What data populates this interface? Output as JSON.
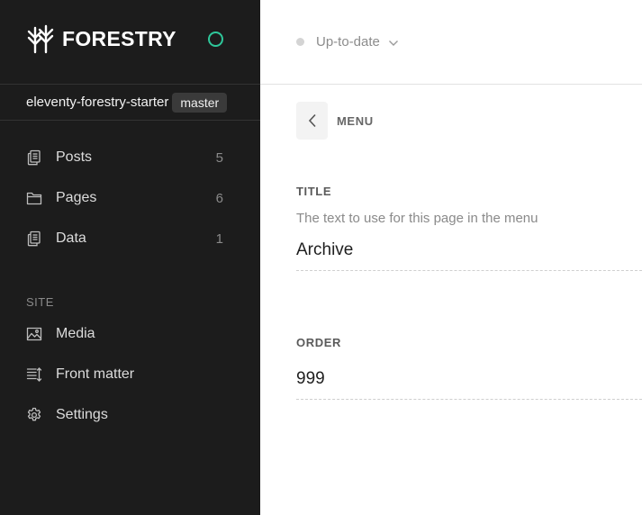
{
  "brand": {
    "name": "FORESTRY",
    "status_color": "#2ec79a"
  },
  "repo": {
    "name": "eleventy-forestry-starter",
    "branch": "master"
  },
  "nav": {
    "content": [
      {
        "label": "Posts",
        "count": "5",
        "icon": "document-stack-icon"
      },
      {
        "label": "Pages",
        "count": "6",
        "icon": "folder-icon"
      },
      {
        "label": "Data",
        "count": "1",
        "icon": "document-stack-icon"
      }
    ],
    "site_label": "SITE",
    "site": [
      {
        "label": "Media",
        "icon": "image-icon"
      },
      {
        "label": "Front matter",
        "icon": "front-matter-icon"
      },
      {
        "label": "Settings",
        "icon": "gear-icon"
      }
    ]
  },
  "topbar": {
    "sync_status": "Up-to-date"
  },
  "editor": {
    "breadcrumb": "MENU",
    "fields": [
      {
        "label": "TITLE",
        "help": "The text to use for this page in the menu",
        "value": "Archive"
      },
      {
        "label": "ORDER",
        "help": "",
        "value": "999"
      }
    ]
  }
}
